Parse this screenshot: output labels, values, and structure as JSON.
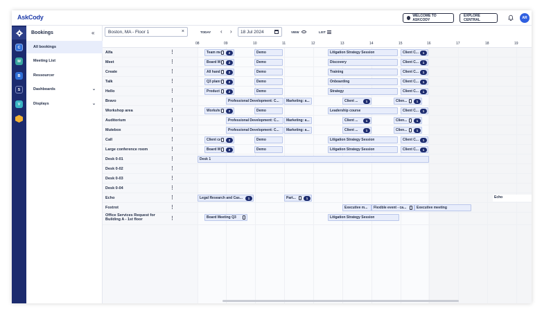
{
  "header": {
    "logo": "AskCody",
    "welcome_label": "WELCOME TO ASKCODY",
    "explore_label": "EXPLORE CENTRAL",
    "avatar_initials": "AR"
  },
  "rail": {
    "items": [
      {
        "icon": "gear-icon",
        "letter": "",
        "color": "#2d3f88"
      },
      {
        "icon": "c-app-icon",
        "letter": "C",
        "color": "#2f6fd6"
      },
      {
        "icon": "m-app-icon",
        "letter": "M",
        "color": "#3aa7a0"
      },
      {
        "icon": "b-app-icon",
        "letter": "B",
        "color": "#2f6fd6"
      },
      {
        "icon": "s-app-icon",
        "letter": "S",
        "color": "#1c2b6e"
      },
      {
        "icon": "v-app-icon",
        "letter": "V",
        "color": "#3ab5c4"
      },
      {
        "icon": "hex-app-icon",
        "letter": "",
        "color": "#f2b233"
      }
    ]
  },
  "menu": {
    "title": "Bookings",
    "items": [
      {
        "label": "All bookings",
        "active": true
      },
      {
        "label": "Meeting List"
      },
      {
        "label": "Ressourcer"
      },
      {
        "label": "Dashboards",
        "chevron": true
      },
      {
        "label": "Displays",
        "chevron": true
      }
    ]
  },
  "toolbar": {
    "location_value": "Boston, MA - Floor 1",
    "today_label": "TODAY",
    "date_value": "18 Jul 2024",
    "view_label": "VIEW",
    "list_label": "LIST"
  },
  "hours": [
    "08",
    "09",
    "10",
    "11",
    "12",
    "13",
    "14",
    "15",
    "16",
    "17",
    "18",
    "19"
  ],
  "rows": [
    {
      "name": "Alfa"
    },
    {
      "name": "Meet"
    },
    {
      "name": "Create"
    },
    {
      "name": "Talk"
    },
    {
      "name": "Hello"
    },
    {
      "name": "Bravo"
    },
    {
      "name": "Workshop area"
    },
    {
      "name": "Auditorium"
    },
    {
      "name": "Mutebox"
    },
    {
      "name": "Call"
    },
    {
      "name": "Large conference room"
    },
    {
      "name": "Desk 0-01"
    },
    {
      "name": "Desk 0-02"
    },
    {
      "name": "Desk 0-03"
    },
    {
      "name": "Desk 0-04"
    },
    {
      "name": "Echo"
    },
    {
      "name": "Foxtrot"
    },
    {
      "name": "Office Services Request for Building A - 1st floor"
    }
  ],
  "events": [
    {
      "row": 0,
      "label": "Team meeting",
      "badge": "2",
      "doc": true
    },
    {
      "row": 0,
      "label": "Demo"
    },
    {
      "row": 0,
      "label": "Litigation Strategy Session"
    },
    {
      "row": 0,
      "label": "Client C...",
      "badge": "1"
    },
    {
      "row": 1,
      "label": "Board Meeti...",
      "badge": "2",
      "doc": true
    },
    {
      "row": 1,
      "label": "Demo"
    },
    {
      "row": 1,
      "label": "Discovery"
    },
    {
      "row": 1,
      "label": "Client C...",
      "badge": "1"
    },
    {
      "row": 2,
      "label": "All hands on ...",
      "badge": "2",
      "doc": true
    },
    {
      "row": 2,
      "label": "Demo"
    },
    {
      "row": 2,
      "label": "Training"
    },
    {
      "row": 2,
      "label": "Client C...",
      "badge": "1"
    },
    {
      "row": 3,
      "label": "Q3 planning",
      "badge": "2",
      "doc": true
    },
    {
      "row": 3,
      "label": "Demo"
    },
    {
      "row": 3,
      "label": "Onboarding"
    },
    {
      "row": 3,
      "label": "Client C...",
      "badge": "1"
    },
    {
      "row": 4,
      "label": "Product walk...",
      "badge": "2",
      "doc": true
    },
    {
      "row": 4,
      "label": "Demo"
    },
    {
      "row": 4,
      "label": "Strategy"
    },
    {
      "row": 4,
      "label": "Client C...",
      "badge": "1"
    },
    {
      "row": 5,
      "label": "Professional Development: C..."
    },
    {
      "row": 5,
      "label": "Marketing: a..."
    },
    {
      "row": 5,
      "label": "Client ...",
      "badge": "1"
    },
    {
      "row": 5,
      "label": "Clien...",
      "badge": "1",
      "doc": true
    },
    {
      "row": 6,
      "label": "Workshop",
      "badge": "2",
      "doc": true
    },
    {
      "row": 6,
      "label": "Demo"
    },
    {
      "row": 6,
      "label": "Leadership course"
    },
    {
      "row": 6,
      "label": "Client C...",
      "badge": "1"
    },
    {
      "row": 7,
      "label": "Professional Development: C..."
    },
    {
      "row": 7,
      "label": "Marketing: a..."
    },
    {
      "row": 7,
      "label": "Client ...",
      "badge": "1"
    },
    {
      "row": 7,
      "label": "Clien...",
      "badge": "1",
      "doc": true
    },
    {
      "row": 8,
      "label": "Professional Development: C..."
    },
    {
      "row": 8,
      "label": "Marketing: a..."
    },
    {
      "row": 8,
      "label": "Client ...",
      "badge": "1"
    },
    {
      "row": 8,
      "label": "Clien...",
      "badge": "1",
      "doc": true
    },
    {
      "row": 9,
      "label": "Client call",
      "badge": "2",
      "doc": true
    },
    {
      "row": 9,
      "label": "Demo"
    },
    {
      "row": 9,
      "label": "Litigation Strategy Session"
    },
    {
      "row": 9,
      "label": "Client C...",
      "badge": "1"
    },
    {
      "row": 10,
      "label": "Board Meeti...",
      "badge": "2",
      "doc": true
    },
    {
      "row": 10,
      "label": "Demo"
    },
    {
      "row": 10,
      "label": "Litigation Strategy Session"
    },
    {
      "row": 10,
      "label": "Client C...",
      "badge": "1"
    },
    {
      "row": 11,
      "label": "Desk 1"
    },
    {
      "row": 15,
      "label": "Legal Research and Cas...",
      "badge": "1"
    },
    {
      "row": 15,
      "label": "Part...",
      "badge": "1",
      "doc": true
    },
    {
      "row": 15,
      "label": "Echo"
    },
    {
      "row": 16,
      "label": "Executive m..."
    },
    {
      "row": 16,
      "label": "Flexible event - ca...",
      "doc": true
    },
    {
      "row": 16,
      "label": "Executive meeting"
    },
    {
      "row": 17,
      "label": "Board Meeting Q3",
      "doc": true
    },
    {
      "row": 17,
      "label": "Litigation Strategy Session"
    }
  ]
}
